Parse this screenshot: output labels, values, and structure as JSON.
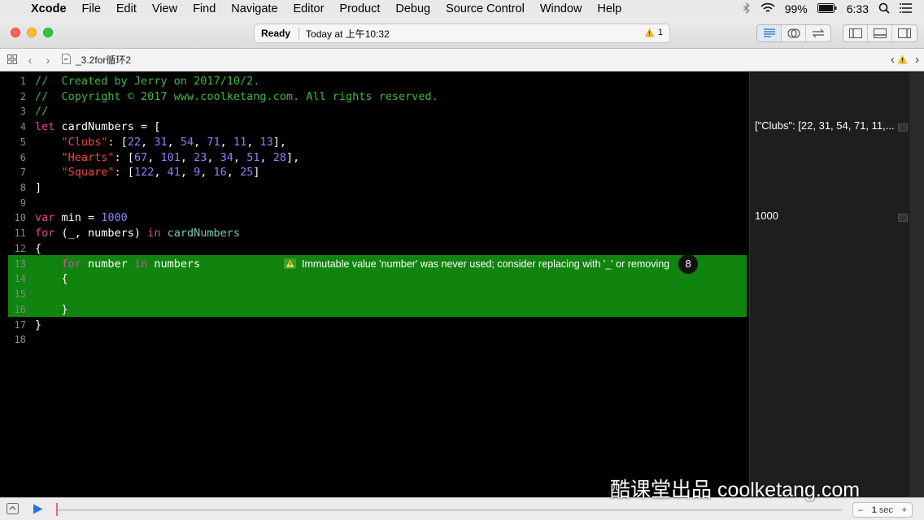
{
  "menubar": {
    "apple": "",
    "items": [
      "Xcode",
      "File",
      "Edit",
      "View",
      "Find",
      "Navigate",
      "Editor",
      "Product",
      "Debug",
      "Source Control",
      "Window",
      "Help"
    ],
    "battery": "99%",
    "time": "6:33"
  },
  "toolbar": {
    "status": "Ready",
    "timestamp": "Today at 上午10:32",
    "warning_count": "1"
  },
  "jumpbar": {
    "filename": "_3.2for循环2"
  },
  "editor": {
    "line_numbers": [
      "1",
      "2",
      "3",
      "4",
      "5",
      "6",
      "7",
      "8",
      "9",
      "10",
      "11",
      "12",
      "13",
      "14",
      "15",
      "16",
      "17",
      "18"
    ],
    "lines": [
      [
        {
          "t": "//  Created by Jerry on 2017/10/2.",
          "c": "cm"
        }
      ],
      [
        {
          "t": "//  Copyright © 2017 www.coolketang.com. All rights reserved.",
          "c": "cm"
        }
      ],
      [
        {
          "t": "//",
          "c": "cm"
        }
      ],
      [
        {
          "t": "let",
          "c": "kw"
        },
        {
          "t": " cardNumbers = [",
          "c": ""
        }
      ],
      [
        {
          "t": "    ",
          "c": ""
        },
        {
          "t": "\"Clubs\"",
          "c": "str"
        },
        {
          "t": ": [",
          "c": ""
        },
        {
          "t": "22",
          "c": "num"
        },
        {
          "t": ", ",
          "c": ""
        },
        {
          "t": "31",
          "c": "num"
        },
        {
          "t": ", ",
          "c": ""
        },
        {
          "t": "54",
          "c": "num"
        },
        {
          "t": ", ",
          "c": ""
        },
        {
          "t": "71",
          "c": "num"
        },
        {
          "t": ", ",
          "c": ""
        },
        {
          "t": "11",
          "c": "num"
        },
        {
          "t": ", ",
          "c": ""
        },
        {
          "t": "13",
          "c": "num"
        },
        {
          "t": "],",
          "c": ""
        }
      ],
      [
        {
          "t": "    ",
          "c": ""
        },
        {
          "t": "\"Hearts\"",
          "c": "str"
        },
        {
          "t": ": [",
          "c": ""
        },
        {
          "t": "67",
          "c": "num"
        },
        {
          "t": ", ",
          "c": ""
        },
        {
          "t": "101",
          "c": "num"
        },
        {
          "t": ", ",
          "c": ""
        },
        {
          "t": "23",
          "c": "num"
        },
        {
          "t": ", ",
          "c": ""
        },
        {
          "t": "34",
          "c": "num"
        },
        {
          "t": ", ",
          "c": ""
        },
        {
          "t": "51",
          "c": "num"
        },
        {
          "t": ", ",
          "c": ""
        },
        {
          "t": "28",
          "c": "num"
        },
        {
          "t": "],",
          "c": ""
        }
      ],
      [
        {
          "t": "    ",
          "c": ""
        },
        {
          "t": "\"Square\"",
          "c": "str"
        },
        {
          "t": ": [",
          "c": ""
        },
        {
          "t": "122",
          "c": "num"
        },
        {
          "t": ", ",
          "c": ""
        },
        {
          "t": "41",
          "c": "num"
        },
        {
          "t": ", ",
          "c": ""
        },
        {
          "t": "9",
          "c": "num"
        },
        {
          "t": ", ",
          "c": ""
        },
        {
          "t": "16",
          "c": "num"
        },
        {
          "t": ", ",
          "c": ""
        },
        {
          "t": "25",
          "c": "num"
        },
        {
          "t": "]",
          "c": ""
        }
      ],
      [
        {
          "t": "]",
          "c": ""
        }
      ],
      [],
      [
        {
          "t": "var",
          "c": "kw"
        },
        {
          "t": " min = ",
          "c": ""
        },
        {
          "t": "1000",
          "c": "num"
        }
      ],
      [
        {
          "t": "for",
          "c": "kw"
        },
        {
          "t": " (_, numbers) ",
          "c": ""
        },
        {
          "t": "in",
          "c": "kw"
        },
        {
          "t": " ",
          "c": ""
        },
        {
          "t": "cardNumbers",
          "c": "id"
        }
      ],
      [
        {
          "t": "{",
          "c": ""
        }
      ],
      [
        {
          "t": "    ",
          "c": ""
        },
        {
          "t": "for",
          "c": "kw"
        },
        {
          "t": " number ",
          "c": ""
        },
        {
          "t": "in",
          "c": "kw"
        },
        {
          "t": " numbers",
          "c": ""
        }
      ],
      [
        {
          "t": "    {",
          "c": ""
        }
      ],
      [],
      [
        {
          "t": "    }",
          "c": ""
        }
      ],
      [
        {
          "t": "}",
          "c": ""
        }
      ],
      []
    ],
    "issue_message": "Immutable value 'number' was never used; consider replacing with '_' or removing",
    "issue_badge": "8"
  },
  "results": [
    {
      "line": 4,
      "text": "[\"Clubs\": [22, 31, 54, 71, 11,..."
    },
    {
      "line": 10,
      "text": "1000"
    }
  ],
  "bottombar": {
    "stepper_value": "1",
    "stepper_unit": "sec",
    "minus": "–",
    "plus": "+"
  },
  "watermark": "酷课堂出品 coolketang.com",
  "colors": {
    "highlight": "#11830f",
    "comment": "#41b645",
    "keyword": "#e04c9d",
    "string": "#f4483d",
    "number": "#8a83ff"
  }
}
